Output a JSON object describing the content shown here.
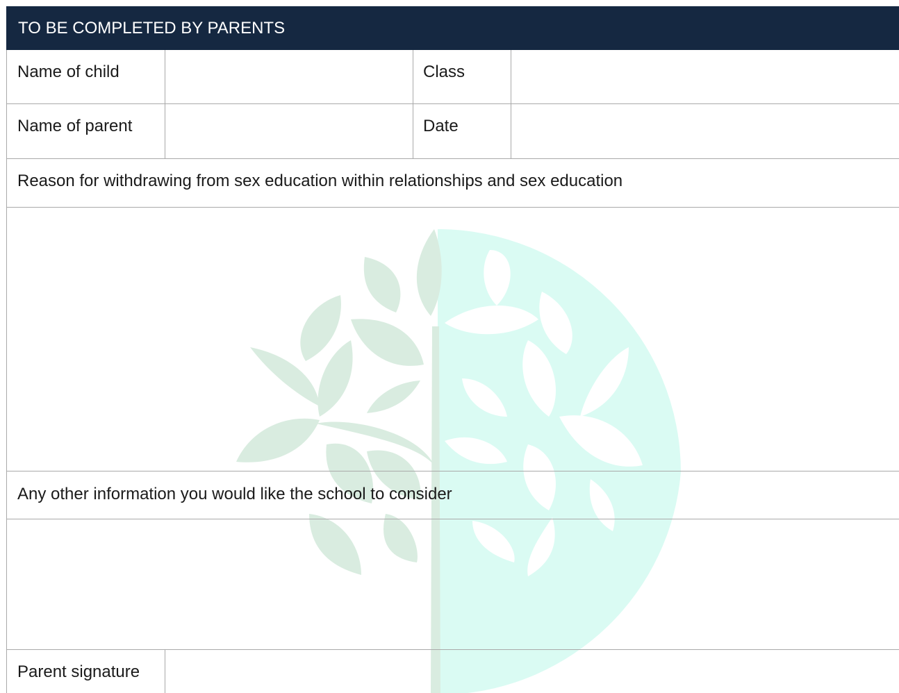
{
  "form": {
    "header_title": "TO BE COMPLETED BY PARENTS",
    "row1": {
      "child_label": "Name of child",
      "child_value": "",
      "class_label": "Class",
      "class_value": ""
    },
    "row2": {
      "parent_label": "Name of parent",
      "parent_value": "",
      "date_label": "Date",
      "date_value": ""
    },
    "reason_label": "Reason for withdrawing from sex education within relationships and sex education",
    "reason_value": "",
    "other_label": "Any other information you would like the school to consider",
    "other_value": "",
    "signature_label": "Parent signature",
    "signature_value": ""
  },
  "colors": {
    "header_bg": "#152841",
    "header_text": "#ffffff",
    "grid_line": "#a9a9a9",
    "watermark_green": "#d9ece0",
    "watermark_mint": "#dafbf3"
  }
}
